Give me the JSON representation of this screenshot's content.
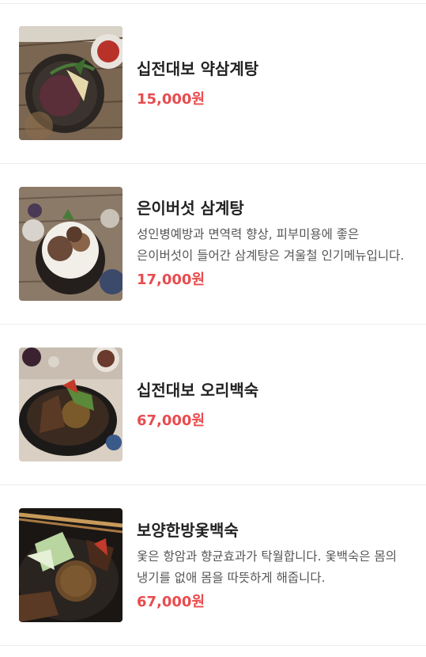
{
  "colors": {
    "title": "#222222",
    "description": "#555555",
    "price": "#e84c4f",
    "divider": "#ececec"
  },
  "menu_items": [
    {
      "name": "십전대보 약삼계탕",
      "description": "",
      "price": "15,000원",
      "image": "black-rice-samgyetang-photo"
    },
    {
      "name": "은이버섯 삼계탕",
      "description": "성인병예방과 면역력 향상, 피부미용에 좋은 은이버섯이 들어간 삼계탕은 겨울철 인기메뉴입니다.",
      "price": "17,000원",
      "image": "mushroom-samgyetang-photo"
    },
    {
      "name": "십전대보 오리백숙",
      "description": "",
      "price": "67,000원",
      "image": "duck-baeksuk-photo"
    },
    {
      "name": "보양한방옻백숙",
      "description": "옻은 항암과 향균효과가 탁월합니다. 옻백숙은 몸의 냉기를 없애 몸을 따뜻하게 해줍니다.",
      "price": "67,000원",
      "image": "herbal-baeksuk-photo"
    }
  ]
}
